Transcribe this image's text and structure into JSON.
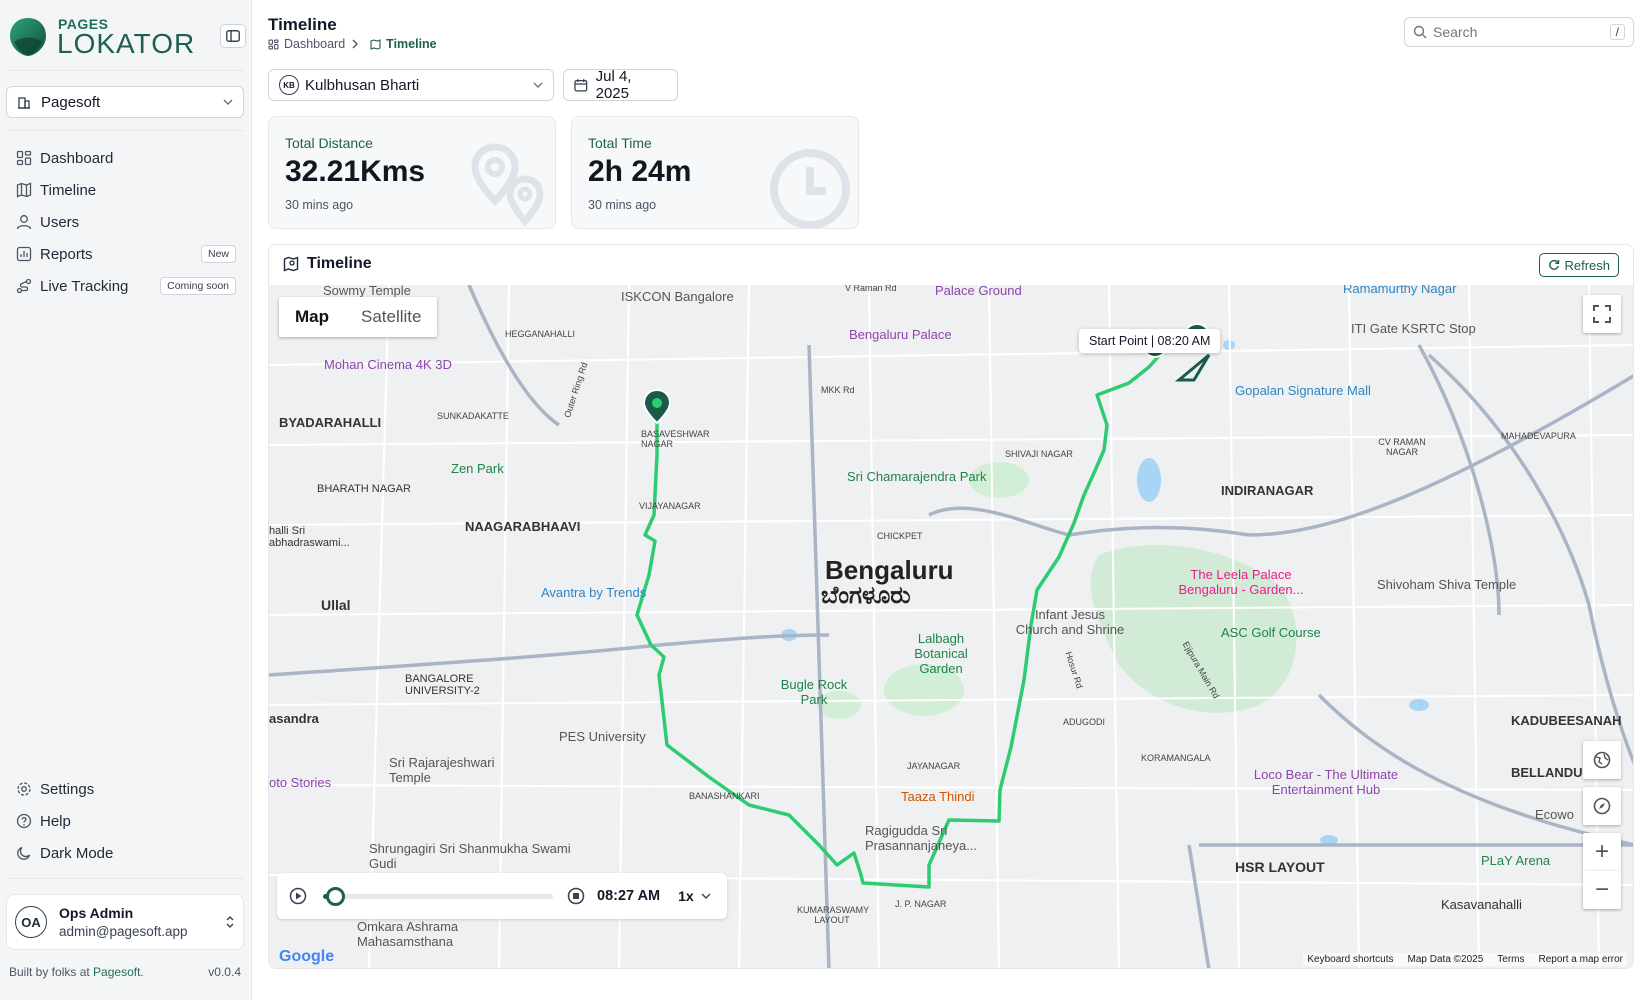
{
  "brand": {
    "small": "PAGES",
    "big": "LOKATOR"
  },
  "org": {
    "selected": "Pagesoft"
  },
  "nav": [
    {
      "label": "Dashboard",
      "badge": ""
    },
    {
      "label": "Timeline",
      "badge": ""
    },
    {
      "label": "Users",
      "badge": ""
    },
    {
      "label": "Reports",
      "badge": "New"
    },
    {
      "label": "Live Tracking",
      "badge": "Coming soon"
    }
  ],
  "nav_bottom": [
    {
      "label": "Settings"
    },
    {
      "label": "Help"
    },
    {
      "label": "Dark Mode"
    }
  ],
  "user": {
    "initials": "OA",
    "name": "Ops Admin",
    "email": "admin@pagesoft.app"
  },
  "footer": {
    "prefix": "Built by folks at ",
    "brand": "Pagesoft",
    "suffix": ".",
    "version": "v0.0.4"
  },
  "header": {
    "title": "Timeline",
    "breadcrumb": [
      "Dashboard",
      "Timeline"
    ]
  },
  "search": {
    "placeholder": "Search",
    "shortcut": "/"
  },
  "filters": {
    "user_initials": "KB",
    "user_name": "Kulbhusan Bharti",
    "date": "Jul 4, 2025"
  },
  "stats": [
    {
      "title": "Total Distance",
      "value": "32.21Kms",
      "sub": "30 mins ago"
    },
    {
      "title": "Total Time",
      "value": "2h 24m",
      "sub": "30 mins ago"
    }
  ],
  "timeline": {
    "title": "Timeline",
    "refresh_label": "Refresh"
  },
  "map": {
    "types": [
      "Map",
      "Satellite"
    ],
    "active_type": "Map",
    "tooltip": "Start Point | 08:20 AM",
    "start_marker": "S",
    "zoom_in": "+",
    "zoom_out": "−",
    "route_color": "#2ecc71",
    "footer": [
      "Keyboard shortcuts",
      "Map Data ©2025",
      "Terms",
      "Report a map error"
    ],
    "attribution": "Google",
    "labels": [
      {
        "text": "Bengaluru"
      },
      {
        "text": "ಬೆಂಗಳೂರು"
      },
      {
        "text": "ISKCON Bangalore"
      },
      {
        "text": "Palace Ground"
      },
      {
        "text": "Bengaluru Palace"
      },
      {
        "text": "Mohan Cinema 4K 3D"
      },
      {
        "text": "BYADARAHALLI"
      },
      {
        "text": "HEGGANAHALLI"
      },
      {
        "text": "SUNKADAKATTE"
      },
      {
        "text": "BHARATH NAGAR"
      },
      {
        "text": "Zen Park"
      },
      {
        "text": "NAAGARABHAAVI"
      },
      {
        "text": "Ullal"
      },
      {
        "text": "Avantra by Trends"
      },
      {
        "text": "BANGALORE UNIVERSITY-2"
      },
      {
        "text": "PES University"
      },
      {
        "text": "Sri Rajarajeshwari Temple"
      },
      {
        "text": "Shrungagiri Sri Shanmukha Swami Gudi"
      },
      {
        "text": "Omkara Ashrama Mahasamsthana"
      },
      {
        "text": "BASAVESHWAR NAGAR"
      },
      {
        "text": "VIJAYANAGAR"
      },
      {
        "text": "Sri Chamarajendra Park"
      },
      {
        "text": "CHICKPET"
      },
      {
        "text": "Lalbagh Botanical Garden"
      },
      {
        "text": "Bugle Rock Park"
      },
      {
        "text": "BANASHANKARI"
      },
      {
        "text": "JAYANAGAR"
      },
      {
        "text": "Taaza Thindi"
      },
      {
        "text": "Ragigudda Sri Prasannanjaneya..."
      },
      {
        "text": "KUMARASWAMY LAYOUT"
      },
      {
        "text": "J. P. NAGAR"
      },
      {
        "text": "SHIVAJI NAGAR"
      },
      {
        "text": "INDIRANAGAR"
      },
      {
        "text": "Gopalan Signature Mall"
      },
      {
        "text": "ITI Gate KSRTC Stop"
      },
      {
        "text": "Ramamurthy Nagar"
      },
      {
        "text": "CV RAMAN NAGAR"
      },
      {
        "text": "MAHADEVAPURA"
      },
      {
        "text": "The Leela Palace Bengaluru - Garden..."
      },
      {
        "text": "Shivoham Shiva Temple"
      },
      {
        "text": "Infant Jesus Church and Shrine"
      },
      {
        "text": "ASC Golf Course"
      },
      {
        "text": "ADUGODI"
      },
      {
        "text": "KORAMANGALA"
      },
      {
        "text": "Loco Bear - The Ultimate Entertainment Hub"
      },
      {
        "text": "BELLANDUR"
      },
      {
        "text": "KADUBEESANAH"
      },
      {
        "text": "HSR LAYOUT"
      },
      {
        "text": "PLaY Arena"
      },
      {
        "text": "Kasavanahalli"
      },
      {
        "text": "Ecowo"
      },
      {
        "text": "Hosur Rd"
      },
      {
        "text": "Ejipura Main Rd"
      },
      {
        "text": "Outer Ring Rd"
      },
      {
        "text": "MKK Rd"
      },
      {
        "text": "V Raman Rd"
      },
      {
        "text": "Sowmy Temple"
      },
      {
        "text": "halli Sri abhadraswami..."
      },
      {
        "text": "asandra"
      },
      {
        "text": "oto Stories"
      }
    ]
  },
  "player": {
    "current_time": "08:27 AM",
    "speed": "1x",
    "progress": 0.05
  }
}
